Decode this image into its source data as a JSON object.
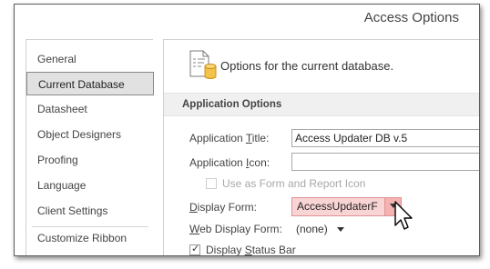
{
  "window": {
    "title": "Access Options"
  },
  "nav": {
    "items": [
      {
        "label": "General"
      },
      {
        "label": "Current Database",
        "selected": true
      },
      {
        "label": "Datasheet"
      },
      {
        "label": "Object Designers"
      },
      {
        "label": "Proofing"
      },
      {
        "label": "Language"
      },
      {
        "label": "Client Settings"
      },
      {
        "label": "Customize Ribbon"
      }
    ]
  },
  "content": {
    "header_text": "Options for the current database.",
    "header_icon": "database-options-icon",
    "section_title": "Application Options",
    "app_title": {
      "label_pre": "Application ",
      "label_key": "T",
      "label_post": "itle:",
      "value": "Access Updater DB v.5"
    },
    "app_icon": {
      "label_pre": "Application ",
      "label_key": "I",
      "label_post": "con:",
      "value": ""
    },
    "use_as_form_icon": {
      "label": "Use as Form and Report Icon",
      "checked": false,
      "disabled": true
    },
    "display_form": {
      "label_key": "D",
      "label_post": "isplay Form:",
      "value": "AccessUpdaterF"
    },
    "web_display_form": {
      "label_key": "W",
      "label_post": "eb Display Form:",
      "value": "(none)"
    },
    "display_status_bar": {
      "label_pre": "Display ",
      "label_key": "S",
      "label_post": "tatus Bar",
      "checked": true
    }
  },
  "colors": {
    "selected_nav_bg": "#e1e1e1",
    "highlight_combo_bg": "#f9d4d4",
    "highlight_combo_border": "#e29292"
  },
  "cursor": {
    "icon": "mouse-pointer-icon"
  }
}
